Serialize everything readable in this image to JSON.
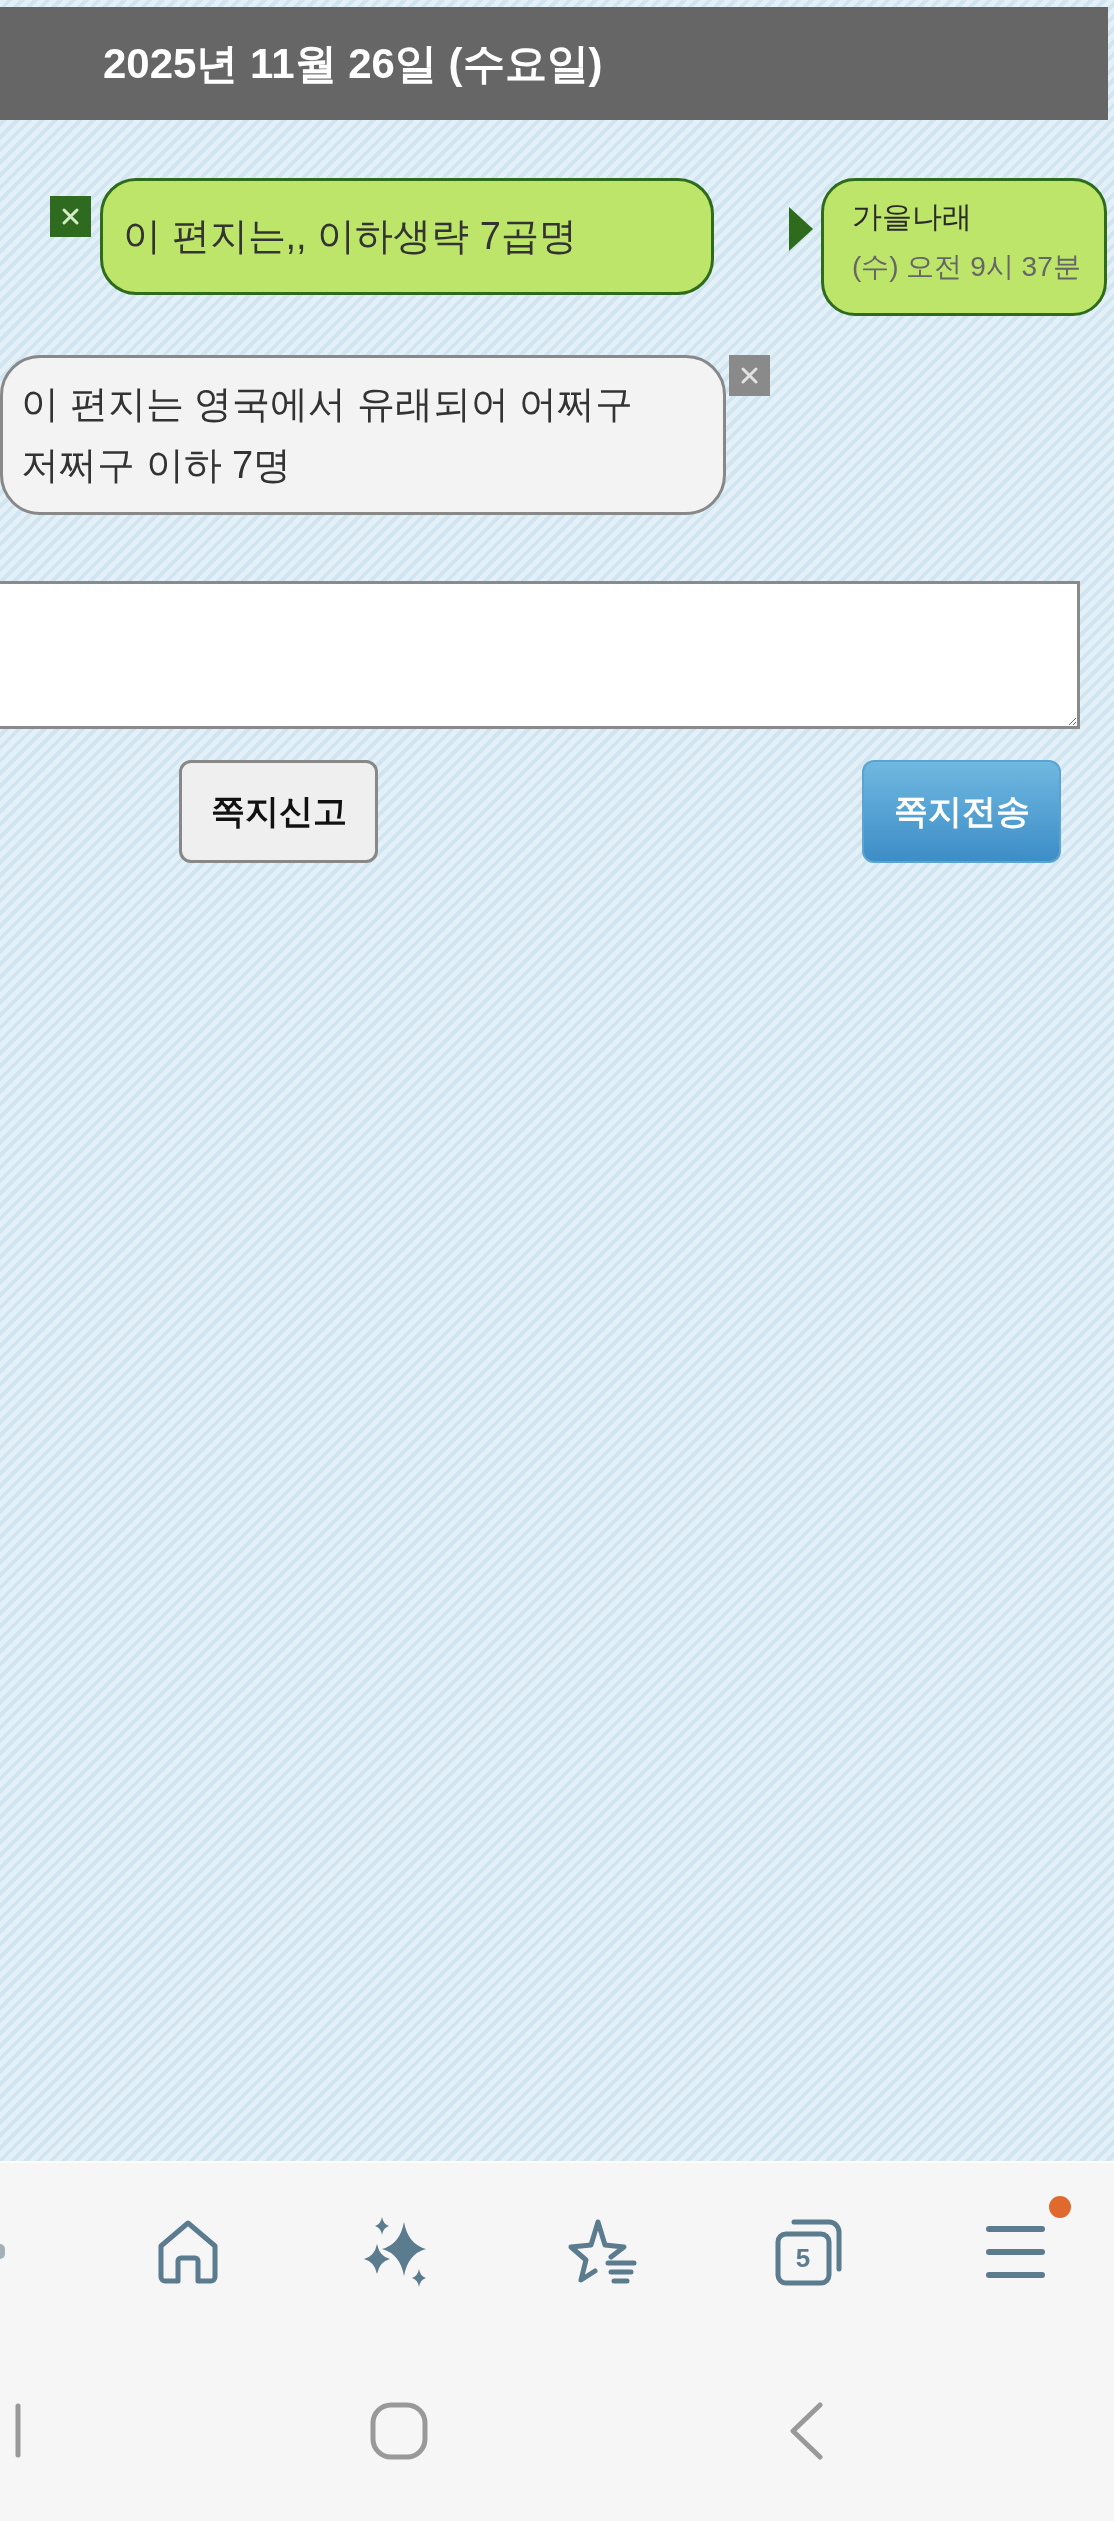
{
  "date_header": {
    "title": "2025년 11월 26일 (수요일)"
  },
  "messages": [
    {
      "kind": "sent",
      "text": "이 편지는,, 이하생략 7곱명",
      "sender_name": "가을나래",
      "time": "(수) 오전 9시 37분"
    },
    {
      "kind": "received",
      "text": "이 편지는 영국에서 유래되어 어쩌구 저쩌구 이하 7명"
    }
  ],
  "compose": {
    "buttons": [
      {
        "kind": "report",
        "label": "쪽지신고"
      },
      {
        "kind": "send",
        "label": "쪽지전송"
      }
    ]
  },
  "browser_toolbar": {
    "tab_count": "5",
    "menu_notification": true
  }
}
